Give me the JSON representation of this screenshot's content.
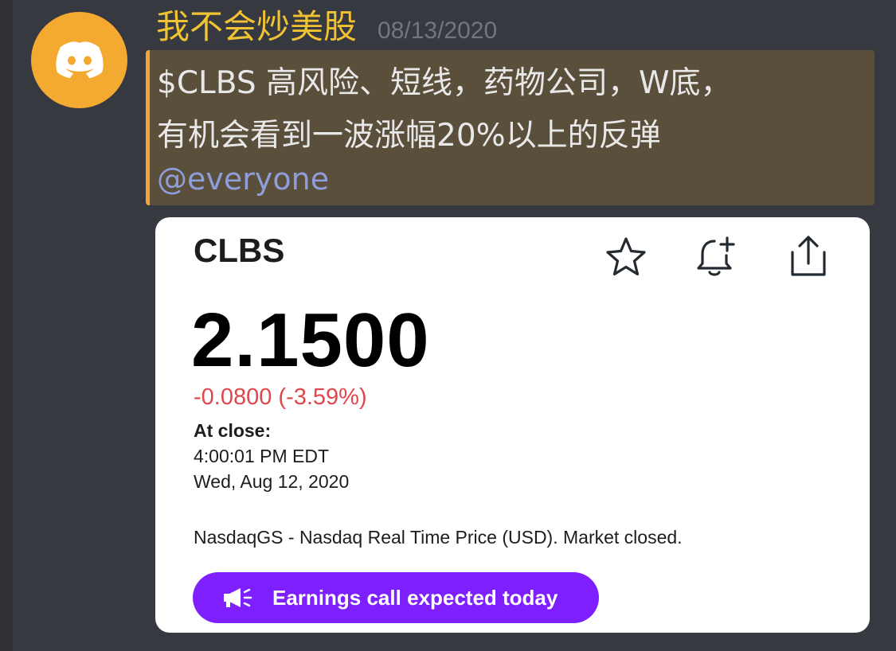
{
  "message": {
    "username": "我不会炒美股",
    "timestamp": "08/13/2020",
    "line1": "$CLBS 高风险、短线，药物公司，W底，",
    "line2": "有机会看到一波涨幅20%以上的反弹",
    "mention": "@everyone",
    "avatar_icon": "discord-logo-icon",
    "colors": {
      "username": "#f1c232",
      "highlight_bg": "#5a4f3b",
      "highlight_border": "#f2a33a",
      "mention": "#8f9ddb"
    }
  },
  "quote": {
    "ticker": "CLBS",
    "price": "2.1500",
    "change": "-0.0800 (-3.59%)",
    "close_label": "At close:",
    "close_time": "4:00:01 PM EDT",
    "close_date": "Wed, Aug 12, 2020",
    "market_note": "NasdaqGS - Nasdaq Real Time Price (USD). Market closed.",
    "earnings_label": "Earnings call expected today",
    "icons": [
      "star-icon",
      "bell-plus-icon",
      "share-icon",
      "megaphone-icon"
    ],
    "colors": {
      "change": "#e0474c",
      "earnings_bg": "#7e1fff"
    }
  }
}
